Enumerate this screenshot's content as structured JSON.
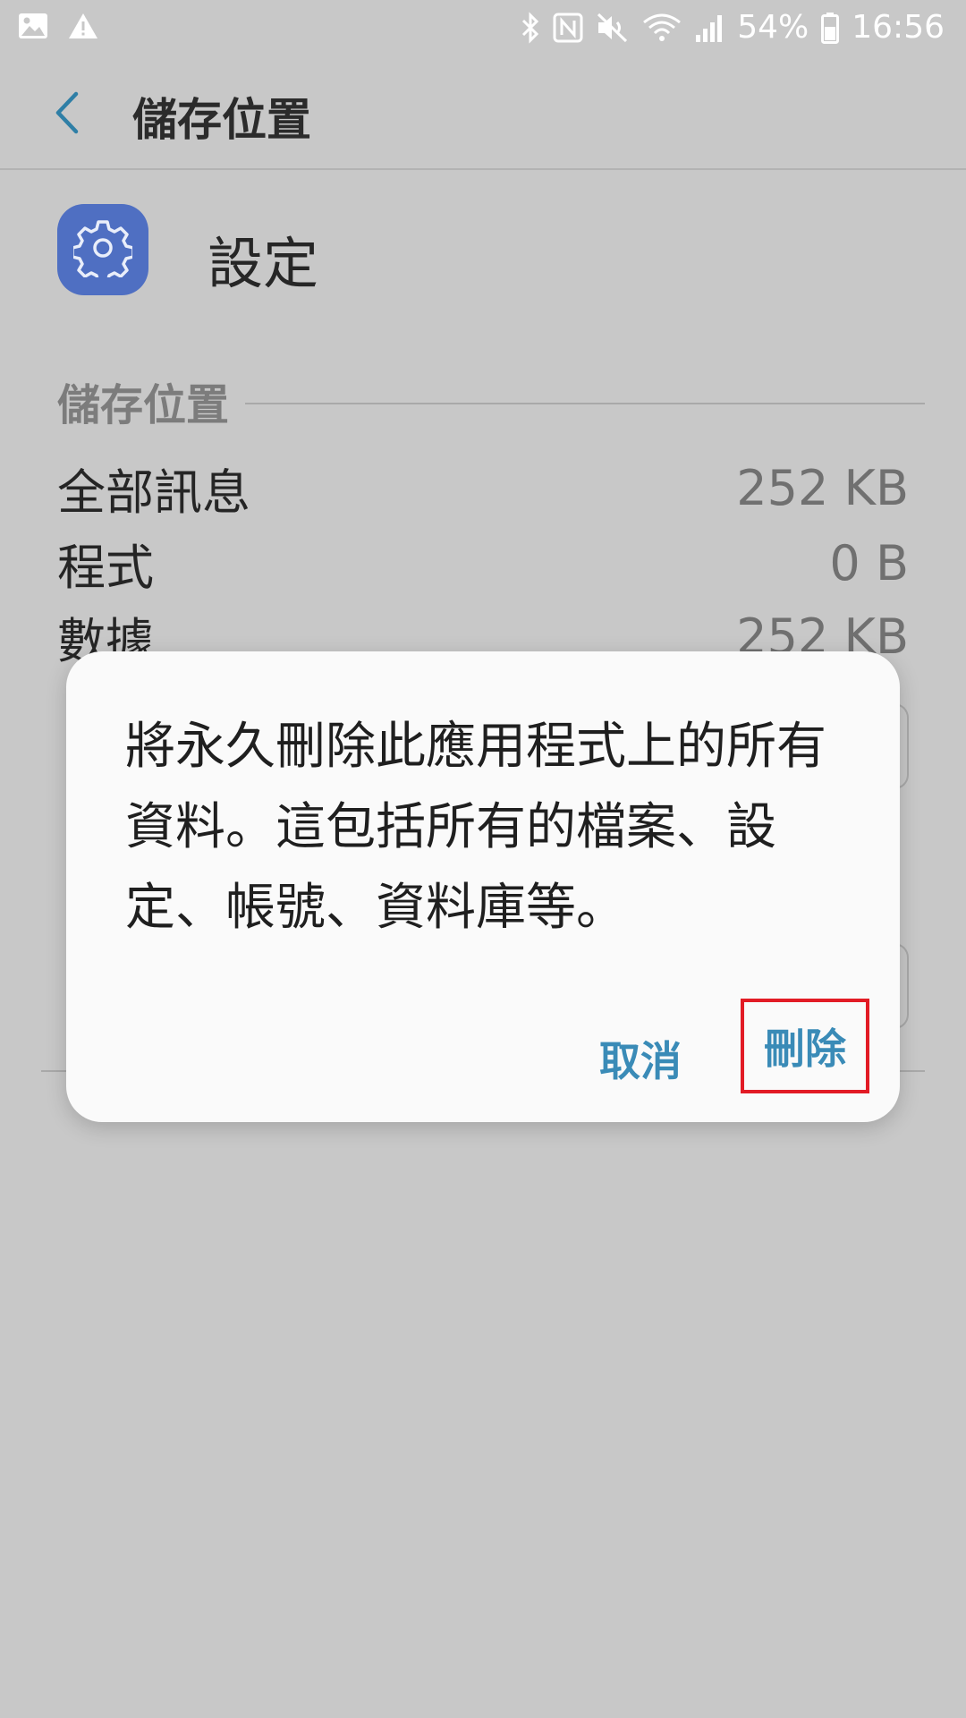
{
  "status_bar": {
    "battery_percent": "54%",
    "time": "16:56"
  },
  "app_bar": {
    "title": "儲存位置"
  },
  "app": {
    "name": "設定"
  },
  "storage": {
    "section_title": "儲存位置",
    "rows": [
      {
        "label": "全部訊息",
        "value": "252 KB"
      },
      {
        "label": "程式",
        "value": "0 B"
      },
      {
        "label": "數據",
        "value": "252 KB"
      }
    ]
  },
  "dialog": {
    "message": "將永久刪除此應用程式上的所有資料。這包括所有的檔案、設定、帳號、資料庫等。",
    "cancel_label": "取消",
    "delete_label": "刪除"
  },
  "colors": {
    "accent": "#3a8bb7",
    "app_icon": "#4f6fc2",
    "highlight_box": "#e21b25",
    "scrim_background": "#c8c8c8"
  }
}
